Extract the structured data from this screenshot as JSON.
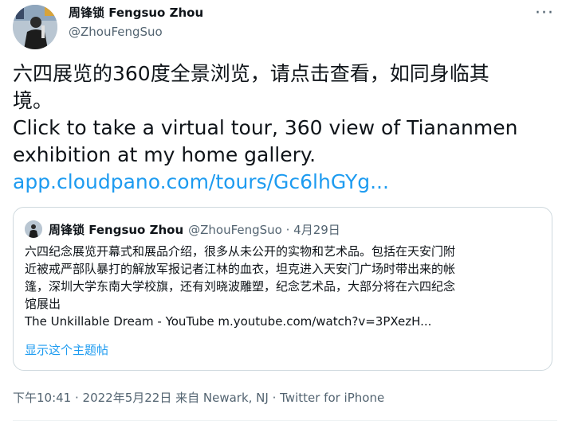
{
  "author": {
    "display_name": "周锋锁 Fengsuo Zhou",
    "handle": "@ZhouFengSuo"
  },
  "more_icon": "more-icon",
  "tweet": {
    "lines": [
      "六四展览的360度全景浏览，请点击查看，如同身临其",
      "境。",
      "Click to take a virtual tour, 360 view of Tiananmen",
      "exhibition at my home gallery."
    ],
    "link": "app.cloudpano.com/tours/Gc6lhGYg..."
  },
  "quote": {
    "name": "周锋锁 Fengsuo Zhou",
    "handle": "@ZhouFengSuo · 4月29日",
    "lines": [
      "六四纪念展览开幕式和展品介绍，很多从未公开的实物和艺术品。包括在天安门附",
      "近被戒严部队暴打的解放军报记者江林的血衣，坦克进入天安门广场时带出来的帐",
      "篷，深圳大学东南大学校旗，还有刘晓波雕塑，纪念艺术品，大部分将在六四纪念",
      "馆展出",
      "The Unkillable Dream - YouTube m.youtube.com/watch?v=3PXezH..."
    ],
    "show_thread": "显示这个主题帖"
  },
  "meta": {
    "timestamp": "下午10:41 · 2022年5月22日 来自 Newark, NJ · ",
    "source": "Twitter for iPhone"
  },
  "colors": {
    "link": "#1d9bf0",
    "secondary": "#536471",
    "border": "#cfd9de"
  }
}
